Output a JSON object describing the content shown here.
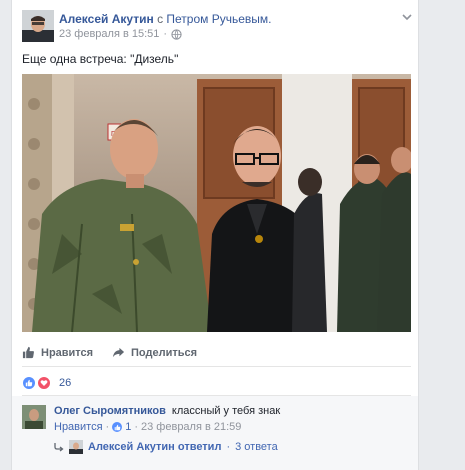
{
  "post": {
    "author": "Алексей Акутин",
    "with_word": "с",
    "tagged": "Петром Ручьевым.",
    "date": "23 февраля в 15:51",
    "dot": "·",
    "text": "Еще одна встреча: \"Дизель\"",
    "photo_sign_text": "ПАРТ"
  },
  "actions": {
    "like_label": "Нравится",
    "share_label": "Поделиться"
  },
  "reactions": {
    "count": "26"
  },
  "comment": {
    "author": "Олег Сыромятников",
    "text": "классный у тебя знак",
    "like_label": "Нравится",
    "sep": "·",
    "like_count": "1",
    "date": "23 февраля в 21:59"
  },
  "reply": {
    "text": "Алексей Акутин ответил",
    "sep": "·",
    "count": "3 ответа"
  },
  "colors": {
    "link": "#365899",
    "like_blue": "#5890ff",
    "love_red": "#f25268",
    "page_bg": "#e9ebee"
  },
  "icons": {
    "globe": "globe-icon",
    "chevron": "chevron-down-icon",
    "like": "thumbs-up-icon",
    "share": "share-arrow-icon",
    "reply": "reply-arrow-icon"
  }
}
